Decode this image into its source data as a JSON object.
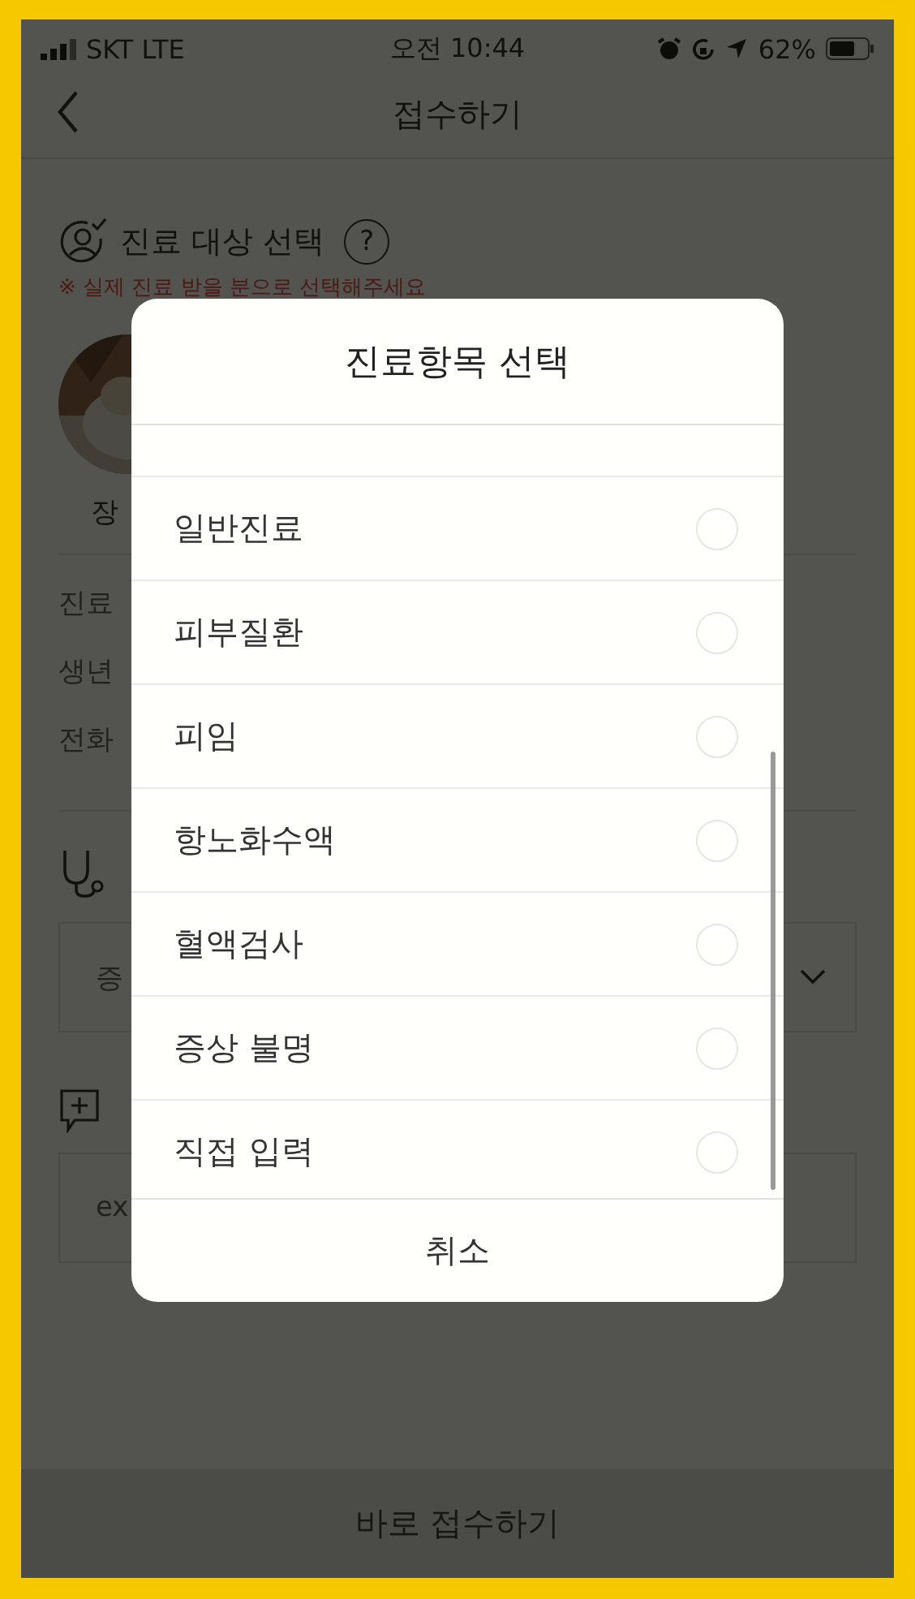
{
  "status_bar": {
    "carrier": "SKT LTE",
    "time": "오전 10:44",
    "battery": "62%"
  },
  "header": {
    "title": "접수하기"
  },
  "patient_section": {
    "title": "진료 대상 선택",
    "help": "?",
    "note": "※ 실제 진료 받을 분으로 선택해주세요",
    "name": "장",
    "info_labels": [
      "진료",
      "생년",
      "전화"
    ]
  },
  "symptom_field": {
    "placeholder": "증"
  },
  "memo_field": {
    "placeholder": "ex"
  },
  "submit_button": "바로 접수하기",
  "dialog": {
    "title": "진료항목 선택",
    "options": [
      {
        "label": "일반진료",
        "selected": false
      },
      {
        "label": "피부질환",
        "selected": false
      },
      {
        "label": "피임",
        "selected": false
      },
      {
        "label": "항노화수액",
        "selected": false
      },
      {
        "label": "혈액검사",
        "selected": false
      },
      {
        "label": "증상 불명",
        "selected": false
      },
      {
        "label": "직접 입력",
        "selected": false
      }
    ],
    "cancel": "취소"
  }
}
